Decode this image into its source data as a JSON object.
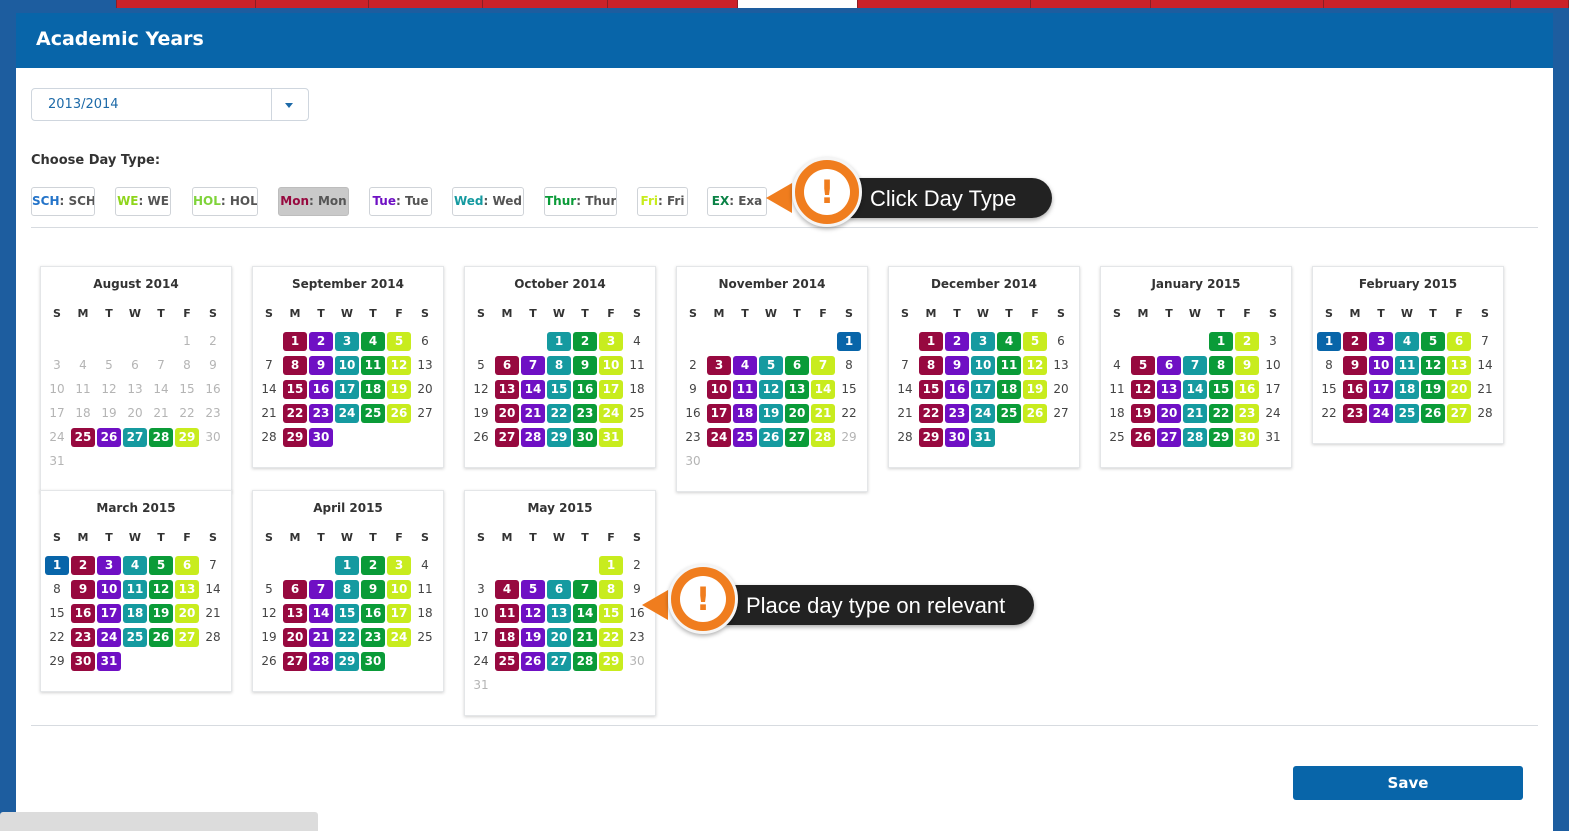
{
  "colors": {
    "SCH": "#0865a9",
    "WE": "#c8ec1e",
    "HOL": "#06a12d",
    "Mon": "#97093f",
    "Tue": "#6f10c4",
    "Wed": "#159aa0",
    "Thur": "#0a9b38",
    "Fri": "#c8ec1e",
    "EX": "#0a8246"
  },
  "header": {
    "title": "Academic Years"
  },
  "year_select": {
    "value": "2013/2014",
    "icon": "chevron-down-icon"
  },
  "daytype": {
    "label": "Choose Day Type:",
    "buttons": [
      {
        "code": "SCH",
        "name": "SCH",
        "color": "#2474c9"
      },
      {
        "code": "WE",
        "name": "WE",
        "color": "#8fd51c"
      },
      {
        "code": "HOL",
        "name": "HOL",
        "color": "#7fd33a"
      },
      {
        "code": "Mon",
        "name": "Mon",
        "color": "#97093f",
        "active": true
      },
      {
        "code": "Tue",
        "name": "Tue",
        "color": "#6f10c4"
      },
      {
        "code": "Wed",
        "name": "Wed",
        "color": "#159aa0"
      },
      {
        "code": "Thur",
        "name": "Thur",
        "color": "#0a9b38"
      },
      {
        "code": "Fri",
        "name": "Fri",
        "color": "#c8ec1e"
      },
      {
        "code": "EX",
        "name": "Exa",
        "color": "#0a8246"
      }
    ]
  },
  "calendar": {
    "weekday_headers": [
      "S",
      "M",
      "T",
      "W",
      "T",
      "F",
      "S"
    ],
    "months": [
      {
        "title": "August 2014",
        "start": 5,
        "days": 31,
        "first": 25,
        "last": 29,
        "fri_ex": [],
        "sch": []
      },
      {
        "title": "September 2014",
        "start": 1,
        "days": 30,
        "first": 1,
        "last": 30,
        "fri_ex": [],
        "sch": []
      },
      {
        "title": "October 2014",
        "start": 3,
        "days": 31,
        "first": 1,
        "last": 31,
        "fri_ex": [],
        "sch": []
      },
      {
        "title": "November 2014",
        "start": 6,
        "days": 30,
        "first": 1,
        "last": 28,
        "fri_ex": [],
        "sch": [
          1
        ]
      },
      {
        "title": "December 2014",
        "start": 1,
        "days": 31,
        "first": 1,
        "last": 31,
        "fri_ex": [],
        "sch": []
      },
      {
        "title": "January 2015",
        "start": 4,
        "days": 31,
        "first": 1,
        "last": 31,
        "fri_ex": [],
        "sch": []
      },
      {
        "title": "February 2015",
        "start": 0,
        "days": 28,
        "first": 1,
        "last": 28,
        "fri_ex": [],
        "sch": [
          1
        ]
      },
      {
        "title": "March 2015",
        "start": 0,
        "days": 31,
        "first": 1,
        "last": 31,
        "fri_ex": [],
        "sch": [
          1
        ]
      },
      {
        "title": "April 2015",
        "start": 3,
        "days": 30,
        "first": 1,
        "last": 30,
        "fri_ex": [],
        "sch": []
      },
      {
        "title": "May 2015",
        "start": 5,
        "days": 31,
        "first": 1,
        "last": 29,
        "fri_ex": [],
        "sch": []
      }
    ]
  },
  "save_label": "Save",
  "callouts": [
    {
      "icon": "exclamation-icon",
      "text": "Click Day Type",
      "glyph": "!"
    },
    {
      "icon": "exclamation-icon",
      "text": "Place day type on relevant",
      "glyph": "!"
    }
  ]
}
